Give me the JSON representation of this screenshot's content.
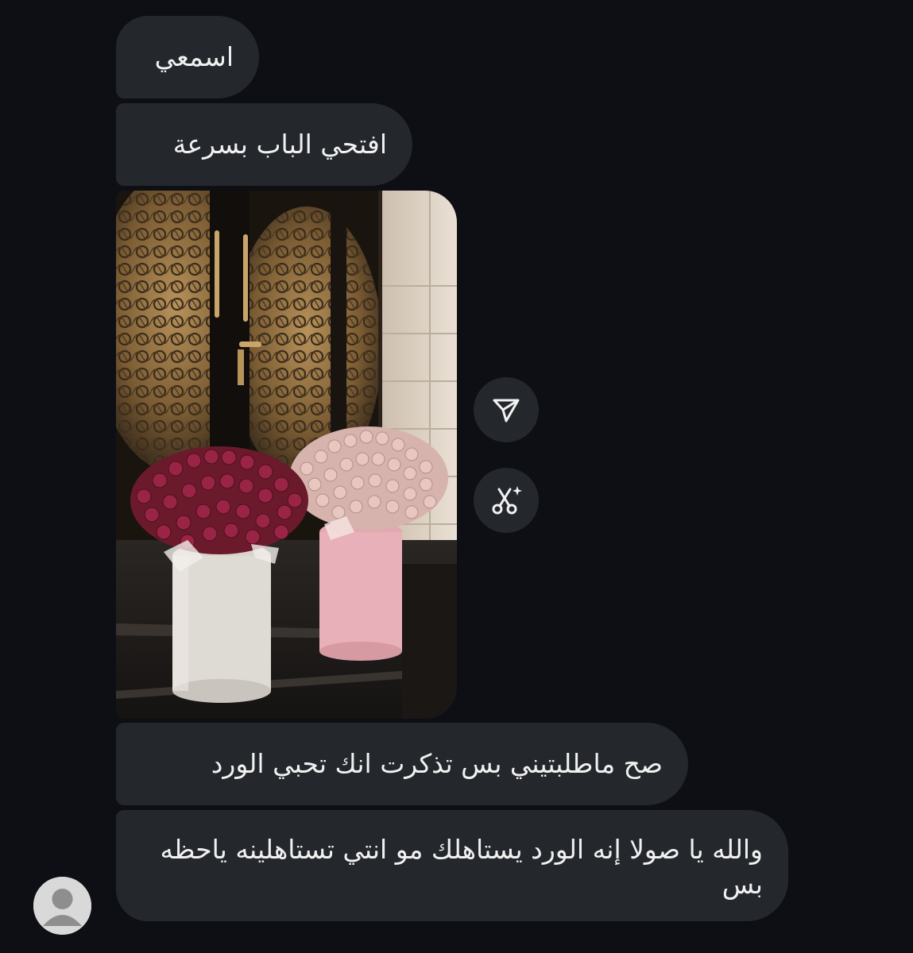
{
  "messages": [
    {
      "text": "اسمعي"
    },
    {
      "text": "افتحي الباب بسرعة"
    },
    {
      "text": "صح ماطلبتيني بس تذكرت انك تحبي الورد"
    },
    {
      "text": "والله يا صولا إنه الورد يستاهلك مو انتي تستاهلينه ياحظه بس"
    }
  ],
  "photo": {
    "icon": "photo-of-flower-bouquets-at-door"
  },
  "actions": {
    "share_icon": "send-icon",
    "ai_icon": "scissors-sparkle-icon"
  },
  "avatar": {
    "icon": "default-user-avatar"
  },
  "colors": {
    "background": "#0d0f14",
    "bubble": "#24272c",
    "text": "#f1f1f1"
  }
}
